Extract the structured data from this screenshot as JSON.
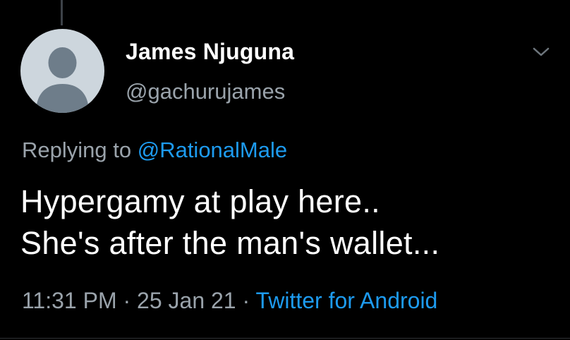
{
  "tweet": {
    "author": {
      "display_name": "James Njuguna",
      "handle": "@gachurujames",
      "avatar_icon": "default-profile-icon"
    },
    "reply_context": {
      "prefix": "Replying to ",
      "mention": "@RationalMale"
    },
    "text_lines": [
      "Hypergamy at play here..",
      "She's after the man's wallet..."
    ],
    "meta": {
      "time": "11:31 PM",
      "separator": "·",
      "date": "25 Jan 21",
      "source": "Twitter for Android"
    },
    "more_icon": "chevron-down-icon"
  },
  "colors": {
    "background": "#000000",
    "primary_text": "#ffffff",
    "secondary_text": "#9aa3ab",
    "accent": "#1d9bf0",
    "avatar_bg": "#cdd6dd",
    "avatar_figure": "#6e7d8a"
  }
}
